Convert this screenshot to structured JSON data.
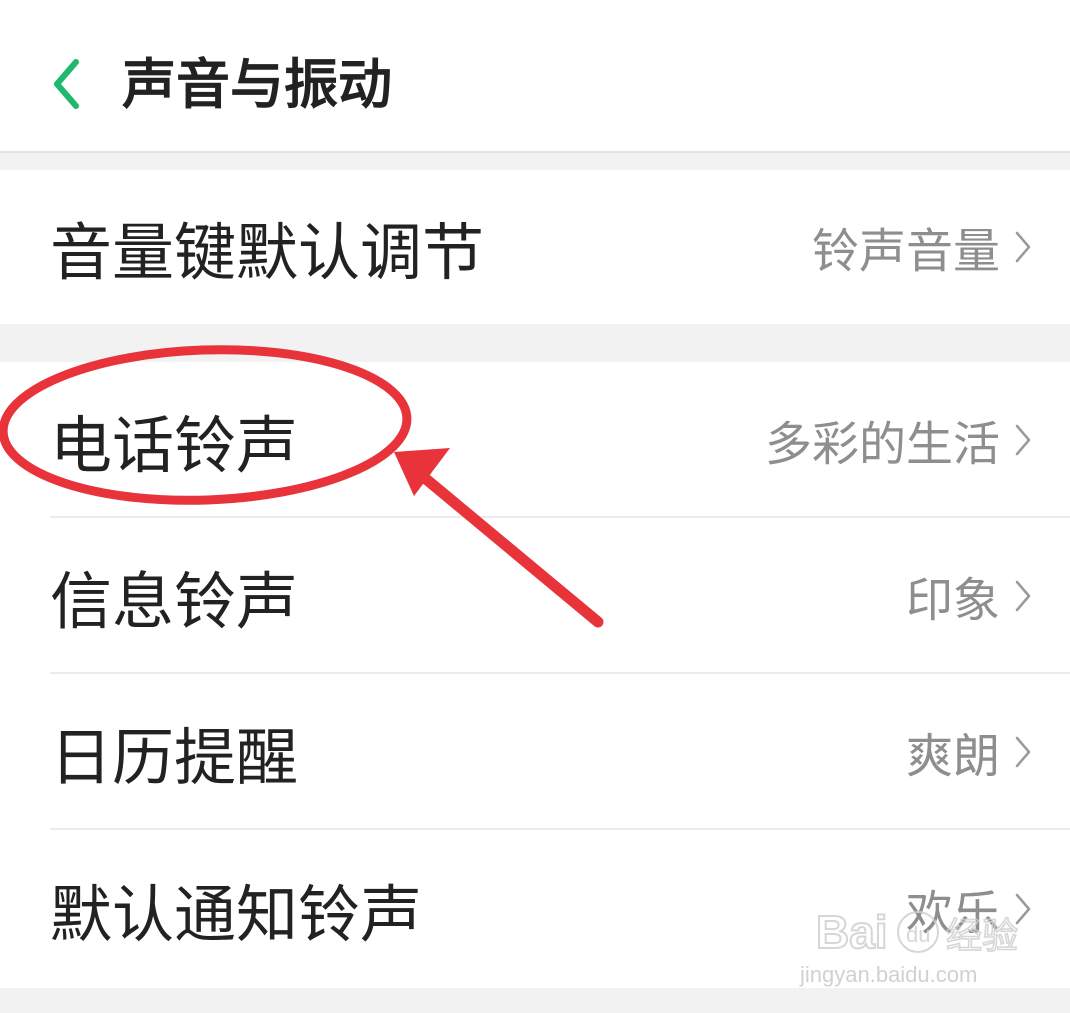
{
  "header": {
    "title": "声音与振动",
    "back_icon": "chevron-left-icon",
    "accent_color": "#1fb96c"
  },
  "volume_group": {
    "items": [
      {
        "label": "音量键默认调节",
        "value": "铃声音量"
      }
    ]
  },
  "ringtone_group": {
    "items": [
      {
        "label": "电话铃声",
        "value": "多彩的生活"
      },
      {
        "label": "信息铃声",
        "value": "印象"
      },
      {
        "label": "日历提醒",
        "value": "爽朗"
      },
      {
        "label": "默认通知铃声",
        "value": "欢乐"
      }
    ]
  },
  "annotation": {
    "color": "#e8333a",
    "shapes": [
      "highlight-ellipse",
      "arrow"
    ]
  },
  "watermark": {
    "logo": "Bai du 经验",
    "url": "jingyan.baidu.com"
  }
}
